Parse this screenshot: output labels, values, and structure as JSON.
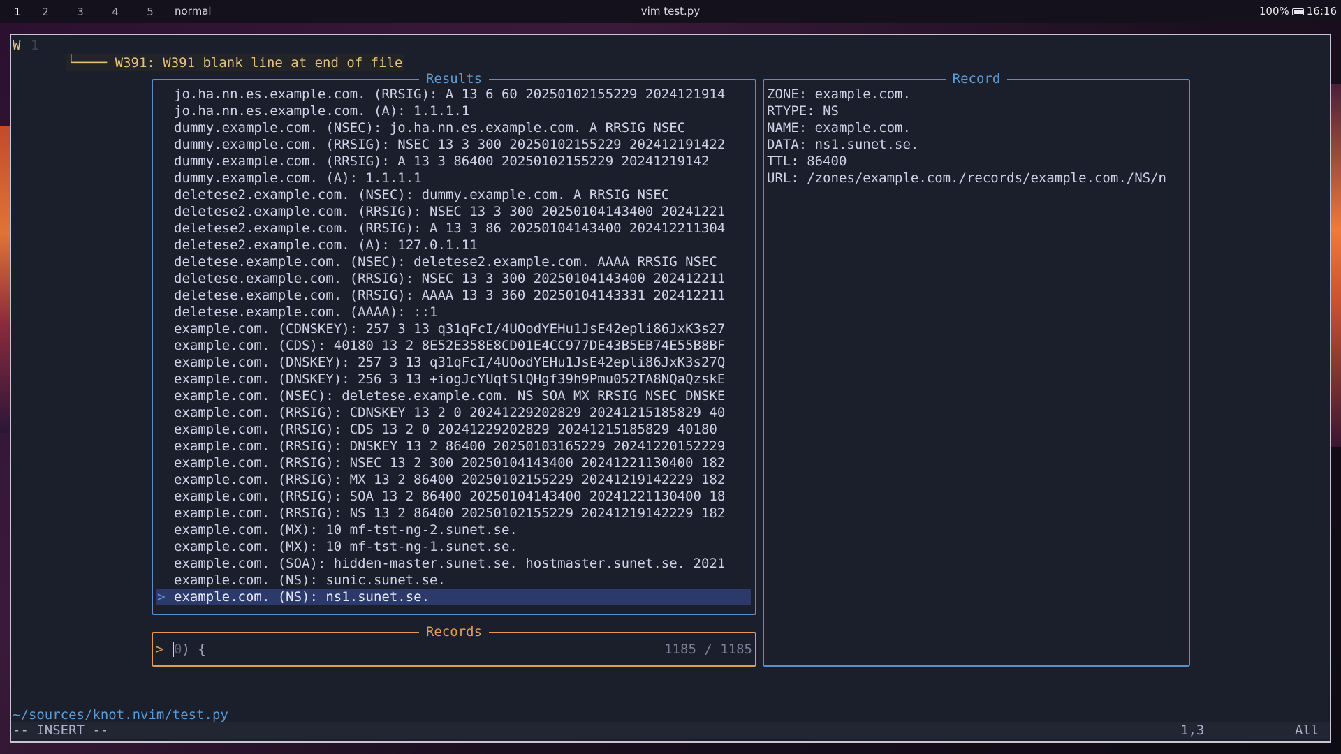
{
  "topbar": {
    "workspaces": [
      "1",
      "2",
      "3",
      "4",
      "5"
    ],
    "mode": "normal",
    "window_title": "vim test.py",
    "battery": "100%",
    "clock": "16:16"
  },
  "editor": {
    "sign": "W",
    "line_number": "1",
    "diagnostic": "└──── W391: W391 blank line at end of file",
    "path": "~/sources/knot.nvim/test.py",
    "mode_indicator": "-- INSERT --",
    "cursor_position": "1,3",
    "scroll": "All"
  },
  "results_panel": {
    "title": "Results",
    "rows": [
      "jo.ha.nn.es.example.com. (RRSIG): A 13 6 60 20250102155229 2024121914",
      "jo.ha.nn.es.example.com. (A): 1.1.1.1",
      "dummy.example.com. (NSEC): jo.ha.nn.es.example.com. A RRSIG NSEC",
      "dummy.example.com. (RRSIG): NSEC 13 3 300 20250102155229 202412191422",
      "dummy.example.com. (RRSIG): A 13 3 86400 20250102155229 20241219142",
      "dummy.example.com. (A): 1.1.1.1",
      "deletese2.example.com. (NSEC): dummy.example.com. A RRSIG NSEC",
      "deletese2.example.com. (RRSIG): NSEC 13 3 300 20250104143400 20241221",
      "deletese2.example.com. (RRSIG): A 13 3 86 20250104143400 202412211304",
      "deletese2.example.com. (A): 127.0.1.11",
      "deletese.example.com. (NSEC): deletese2.example.com. AAAA RRSIG NSEC",
      "deletese.example.com. (RRSIG): NSEC 13 3 300 20250104143400 202412211",
      "deletese.example.com. (RRSIG): AAAA 13 3 360 20250104143331 202412211",
      "deletese.example.com. (AAAA): ::1",
      "example.com. (CDNSKEY): 257 3 13 q31qFcI/4UOodYEHu1JsE42epli86JxK3s27",
      "example.com. (CDS): 40180 13 2 8E52E358E8CD01E4CC977DE43B5EB74E55B8BF",
      "example.com. (DNSKEY): 257 3 13 q31qFcI/4UOodYEHu1JsE42epli86JxK3s27Q",
      "example.com. (DNSKEY): 256 3 13 +iogJcYUqtSlQHgf39h9Pmu052TA8NQaQzskE",
      "example.com. (NSEC): deletese.example.com. NS SOA MX RRSIG NSEC DNSKE",
      "example.com. (RRSIG): CDNSKEY 13 2 0 20241229202829 20241215185829 40",
      "example.com. (RRSIG): CDS 13 2 0 20241229202829 20241215185829 40180",
      "example.com. (RRSIG): DNSKEY 13 2 86400 20250103165229 20241220152229",
      "example.com. (RRSIG): NSEC 13 2 300 20250104143400 20241221130400 182",
      "example.com. (RRSIG): MX 13 2 86400 20250102155229 20241219142229 182",
      "example.com. (RRSIG): SOA 13 2 86400 20250104143400 20241221130400 18",
      "example.com. (RRSIG): NS 13 2 86400 20250102155229 20241219142229 182",
      "example.com. (MX): 10 mf-tst-ng-2.sunet.se.",
      "example.com. (MX): 10 mf-tst-ng-1.sunet.se.",
      "example.com. (SOA): hidden-master.sunet.se. hostmaster.sunet.se. 2021",
      "example.com. (NS): sunic.sunet.se.",
      "example.com. (NS): ns1.sunet.se."
    ],
    "selected_caret": ">"
  },
  "record_panel": {
    "title": "Record",
    "rows": [
      "ZONE: example.com.",
      "RTYPE: NS",
      "NAME: example.com.",
      "DATA: ns1.sunet.se.",
      "TTL: 86400",
      "URL: /zones/example.com./records/example.com./NS/n"
    ]
  },
  "prompt_panel": {
    "title": "Records",
    "caret": ">",
    "input_cursor_char": "0",
    "input_rest": ") {",
    "count": "1185 / 1185"
  },
  "colors": {
    "results_border": "#5b8dcc",
    "prompt_border": "#e39a55",
    "selection": "#2c3a6b",
    "warning": "#e5c07b"
  }
}
